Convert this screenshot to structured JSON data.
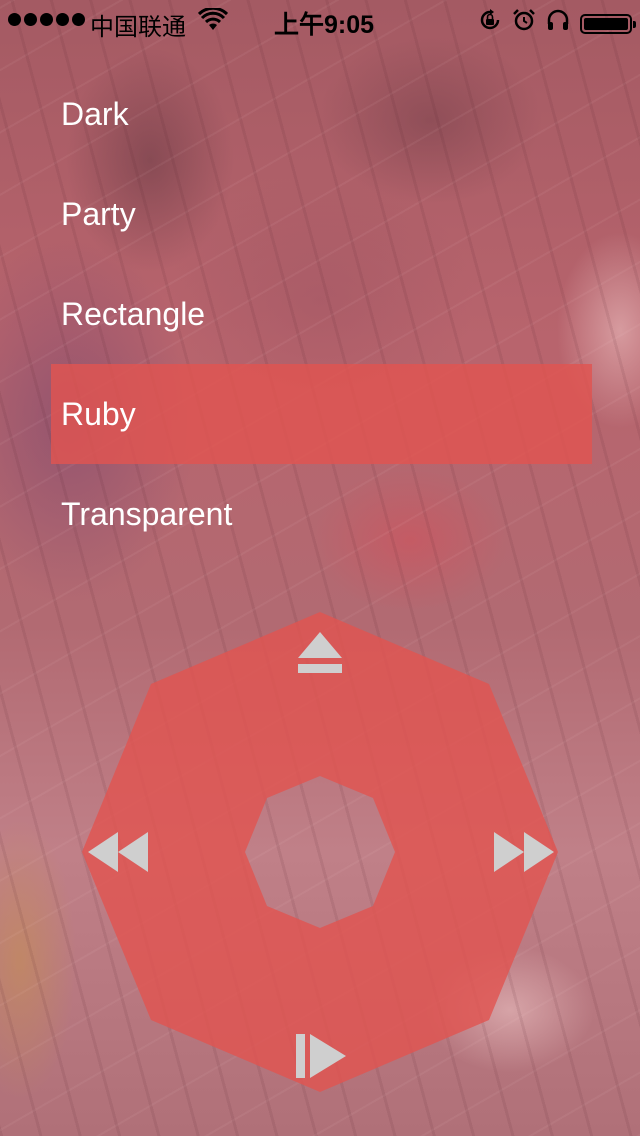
{
  "status_bar": {
    "carrier": "中国联通",
    "time": "上午9:05",
    "battery_level": 1.0,
    "icons": [
      "signal-dots-icon",
      "wifi-icon",
      "rotation-lock-icon",
      "alarm-icon",
      "headphones-icon",
      "battery-icon"
    ]
  },
  "menu": {
    "items": [
      {
        "label": "Dark",
        "selected": false
      },
      {
        "label": "Party",
        "selected": false
      },
      {
        "label": "Rectangle",
        "selected": false
      },
      {
        "label": "Ruby",
        "selected": true
      },
      {
        "label": "Transparent",
        "selected": false
      }
    ]
  },
  "controller": {
    "buttons": [
      "eject-icon",
      "rewind-icon",
      "fast-forward-icon",
      "play-pause-icon"
    ]
  },
  "colors": {
    "accent": "#e05450",
    "menu_text": "#ffffff",
    "control_icon": "#cfcfcf"
  }
}
